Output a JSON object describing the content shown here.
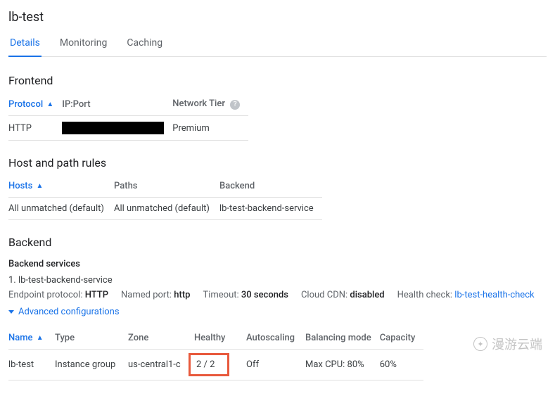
{
  "title": "lb-test",
  "tabs": {
    "details": "Details",
    "monitoring": "Monitoring",
    "caching": "Caching"
  },
  "frontend": {
    "heading": "Frontend",
    "cols": {
      "protocol": "Protocol",
      "ipport": "IP:Port",
      "tier": "Network Tier"
    },
    "row": {
      "protocol": "HTTP",
      "tier": "Premium"
    }
  },
  "rules": {
    "heading": "Host and path rules",
    "cols": {
      "hosts": "Hosts",
      "paths": "Paths",
      "backend": "Backend"
    },
    "row": {
      "hosts": "All unmatched (default)",
      "paths": "All unmatched (default)",
      "backend": "lb-test-backend-service"
    }
  },
  "backend": {
    "heading": "Backend",
    "services_label": "Backend services",
    "service_line": "1. lb-test-backend-service",
    "meta": {
      "ep_label": "Endpoint protocol: ",
      "ep": "HTTP",
      "np_label": "Named port: ",
      "np": "http",
      "to_label": "Timeout: ",
      "to": "30 seconds",
      "cdn_label": "Cloud CDN: ",
      "cdn": "disabled",
      "hc_label": "Health check: ",
      "hc": "lb-test-health-check"
    },
    "advanced": "Advanced configurations",
    "cols": {
      "name": "Name",
      "type": "Type",
      "zone": "Zone",
      "healthy": "Healthy",
      "autoscaling": "Autoscaling",
      "balancing": "Balancing mode",
      "capacity": "Capacity"
    },
    "row": {
      "name": "lb-test",
      "type": "Instance group",
      "zone": "us-central1-c",
      "healthy": "2 / 2",
      "autoscaling": "Off",
      "balancing": "Max CPU: 80%",
      "capacity": "60%"
    }
  },
  "watermark": "漫游云端"
}
